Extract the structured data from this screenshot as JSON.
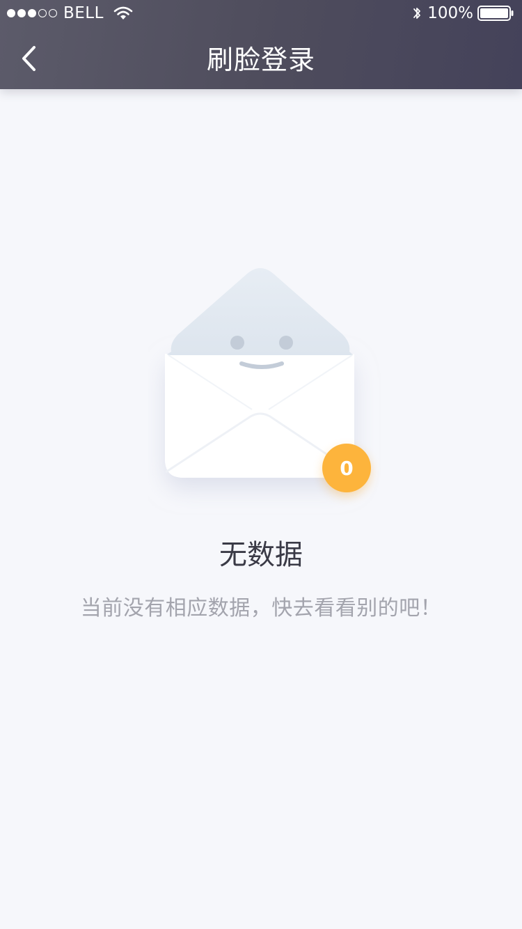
{
  "status_bar": {
    "carrier": "BELL",
    "signal_strength": 3,
    "signal_max": 5,
    "battery_percent": "100%",
    "battery_level": 1.0,
    "icons": [
      "signal-dots-icon",
      "wifi-icon",
      "bluetooth-icon",
      "battery-icon"
    ]
  },
  "nav": {
    "title": "刷脸登录",
    "back_icon": "chevron-left-icon"
  },
  "empty_state": {
    "illustration": "envelope-smiley-icon",
    "badge_count": "0",
    "title": "无数据",
    "description": "当前没有相应数据，快去看看别的吧！"
  },
  "colors": {
    "header_gradient_start": "#5c5b6a",
    "header_gradient_end": "#44425a",
    "page_background": "#f6f7fb",
    "badge": "#fdb43c",
    "title_text": "#3a3a46",
    "description_text": "#a3a4ad"
  }
}
